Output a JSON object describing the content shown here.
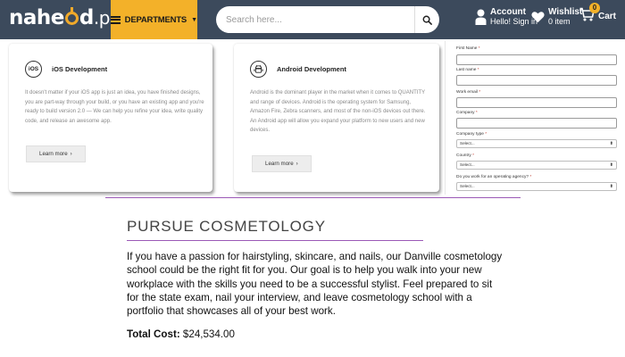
{
  "header": {
    "logo": {
      "prefix": "nahe",
      "suffix": "d",
      "tld": ".pk"
    },
    "departments_label": "DEPARTMENTS",
    "search_placeholder": "Search here...",
    "account": {
      "title": "Account",
      "subtitle": "Hello! Sign in"
    },
    "wishlist": {
      "title": "Wishlist",
      "subtitle": "0 item"
    },
    "cart": {
      "label": "Cart",
      "count": "0"
    },
    "colors": {
      "bar": "#3c4a5c",
      "accent": "#f3b129"
    }
  },
  "cards": [
    {
      "icon_text": "iOS",
      "title": "iOS Development",
      "text": "It doesn't matter if your iOS app is just an idea, you have finished designs, you are part-way through your build, or you have an existing app and you're ready to build version 2.0 — We can help you refine your idea, write quality code, and release an awesome app.",
      "button": "Learn more"
    },
    {
      "title": "Android Development",
      "text": "Android is the dominant player in the market when it comes to QUANTITY and range of devices. Android is the operating system for Samsung, Amazon Fire, Zebra scanners, and most of the non-iOS devices out there.",
      "text2": "An Android app will allow you expand your platform to new users and new devices.",
      "button": "Learn more"
    }
  ],
  "form": {
    "first_name": "First Name",
    "last_name": "Last name",
    "work_email": "Work email",
    "company": "Company",
    "company_type": "Company type",
    "country": "Country",
    "operating_agency": "Do you work for an operating agency?",
    "select_placeholder": "Select..."
  },
  "cosmetology": {
    "title": "PURSUE COSMETOLOGY",
    "body": "If you have a passion for hairstyling, skincare, and nails, our Danville cosmetology school could be the right fit for you. Our goal is to help you walk into your new workplace with the skills you need to be a successful stylist. Feel prepared to sit for the state exam, nail your interview, and leave cosmetology school with a portfolio that showcases all of your best work.",
    "cost_label": "Total Cost:",
    "cost_value": "$24,534.00"
  }
}
